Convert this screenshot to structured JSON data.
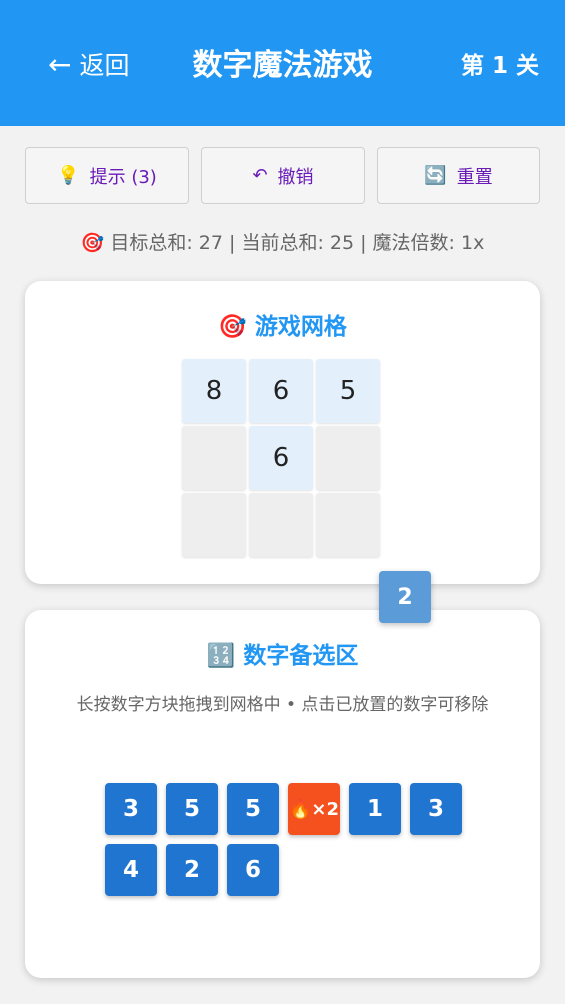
{
  "header": {
    "back_label": "返回",
    "back_arrow": "←",
    "title": "数字魔法游戏",
    "level": "第 1 关"
  },
  "toolbar": {
    "hint": {
      "icon": "💡",
      "label": "提示 (3)"
    },
    "undo": {
      "icon": "↶",
      "label": "撤销"
    },
    "reset": {
      "icon": "🔄",
      "label": "重置"
    }
  },
  "status": {
    "icon": "🎯",
    "text": "目标总和: 27 | 当前总和: 25 | 魔法倍数: 1x"
  },
  "grid_card": {
    "icon": "🎯",
    "title": "游戏网格",
    "cells": [
      "8",
      "6",
      "5",
      "",
      "6",
      "",
      "",
      "",
      ""
    ]
  },
  "dragging_tile": "2",
  "pool_card": {
    "icon": "🔢",
    "title": "数字备选区",
    "hint": "长按数字方块拖拽到网格中 • 点击已放置的数字可移除",
    "tiles": [
      {
        "label": "3",
        "special": false
      },
      {
        "label": "5",
        "special": false
      },
      {
        "label": "5",
        "special": false
      },
      {
        "label": "×2",
        "icon": "🔥",
        "special": true
      },
      {
        "label": "1",
        "special": false
      },
      {
        "label": "3",
        "special": false
      },
      {
        "label": "4",
        "special": false
      },
      {
        "label": "2",
        "special": false
      },
      {
        "label": "6",
        "special": false
      }
    ]
  },
  "colors": {
    "primary": "#2196f3",
    "tile": "#1f75cf",
    "special_tile": "#f4511e",
    "button_text": "#6a1bb8"
  }
}
